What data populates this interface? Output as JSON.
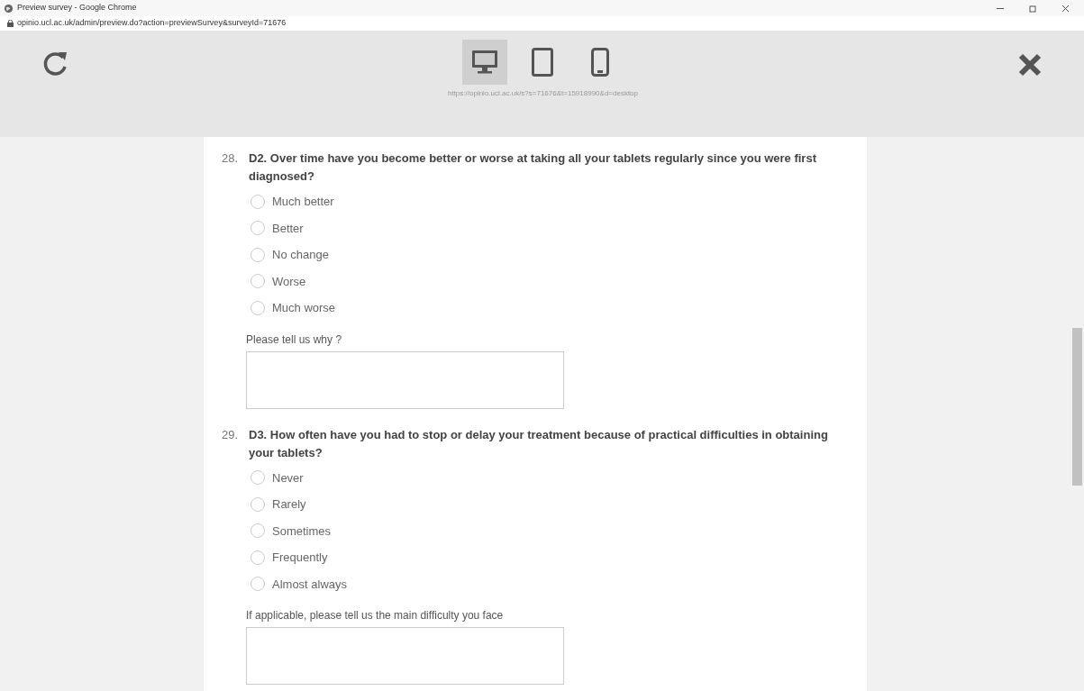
{
  "window": {
    "title": "Preview survey - Google Chrome",
    "address": "opinio.ucl.ac.uk/admin/preview.do?action=previewSurvey&surveyId=71676"
  },
  "toolbar": {
    "devices": [
      {
        "kind": "desktop",
        "selected": true
      },
      {
        "kind": "tablet",
        "selected": false
      },
      {
        "kind": "phone",
        "selected": false
      }
    ],
    "preview_url": "https://opinio.ucl.ac.uk/s?s=71676&t=15918990&d=desktop"
  },
  "questions": [
    {
      "number": "28.",
      "title": "D2. Over time have you become better or worse at taking all your tablets regularly since you were first diagnosed?",
      "options": [
        {
          "label": "Much better",
          "selected": false
        },
        {
          "label": "Better",
          "selected": false
        },
        {
          "label": "No change",
          "selected": false
        },
        {
          "label": "Worse",
          "selected": false
        },
        {
          "label": "Much worse",
          "selected": false
        }
      ],
      "comment_label": "Please tell us why ?"
    },
    {
      "number": "29.",
      "title": "D3. How often have you had to stop or delay your treatment because of practical difficulties in obtaining your tablets?",
      "options": [
        {
          "label": "Never",
          "selected": false
        },
        {
          "label": "Rarely",
          "selected": false
        },
        {
          "label": "Sometimes",
          "selected": false
        },
        {
          "label": "Frequently",
          "selected": false
        },
        {
          "label": "Almost always",
          "selected": false
        }
      ],
      "comment_label": "If applicable, please tell us the main difficulty you face"
    }
  ]
}
